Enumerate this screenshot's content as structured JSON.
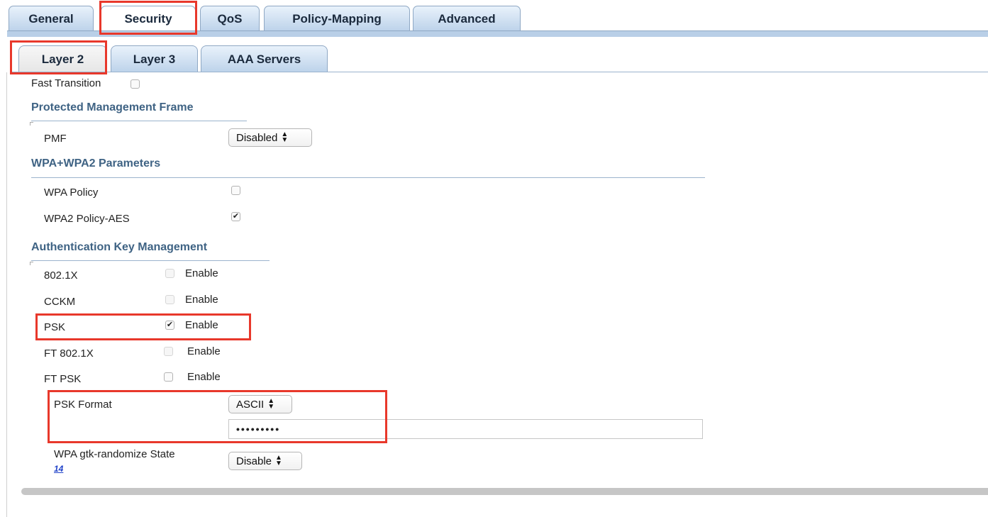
{
  "tabs": [
    "General",
    "Security",
    "QoS",
    "Policy-Mapping",
    "Advanced"
  ],
  "subtabs": [
    "Layer 2",
    "Layer 3",
    "AAA Servers"
  ],
  "fast_transition": {
    "label": "Fast Transition",
    "checked": false
  },
  "pmf_section": {
    "title": "Protected Management Frame",
    "pmf_label": "PMF",
    "pmf_value": "Disabled"
  },
  "wpa_section": {
    "title": "WPA+WPA2 Parameters",
    "wpa_policy_label": "WPA Policy",
    "wpa_policy_checked": false,
    "wpa2_policy_label": "WPA2 Policy-AES",
    "wpa2_policy_checked": true
  },
  "akm_section": {
    "title": "Authentication Key Management",
    "enable_label": "Enable",
    "items": [
      {
        "label": "802.1X",
        "checked": false
      },
      {
        "label": "CCKM",
        "checked": false
      },
      {
        "label": "PSK",
        "checked": true
      },
      {
        "label": "FT 802.1X",
        "checked": false
      },
      {
        "label": "FT PSK",
        "checked": false
      }
    ],
    "psk_format_label": "PSK Format",
    "psk_format_value": "ASCII",
    "psk_value": "•••••••••",
    "gtk_label": "WPA gtk-randomize State",
    "gtk_link": "14",
    "gtk_value": "Disable"
  },
  "colors": {
    "accent_red": "#e8382b",
    "section_title": "#3f6384",
    "tab_fill": "#bcd2ea"
  }
}
